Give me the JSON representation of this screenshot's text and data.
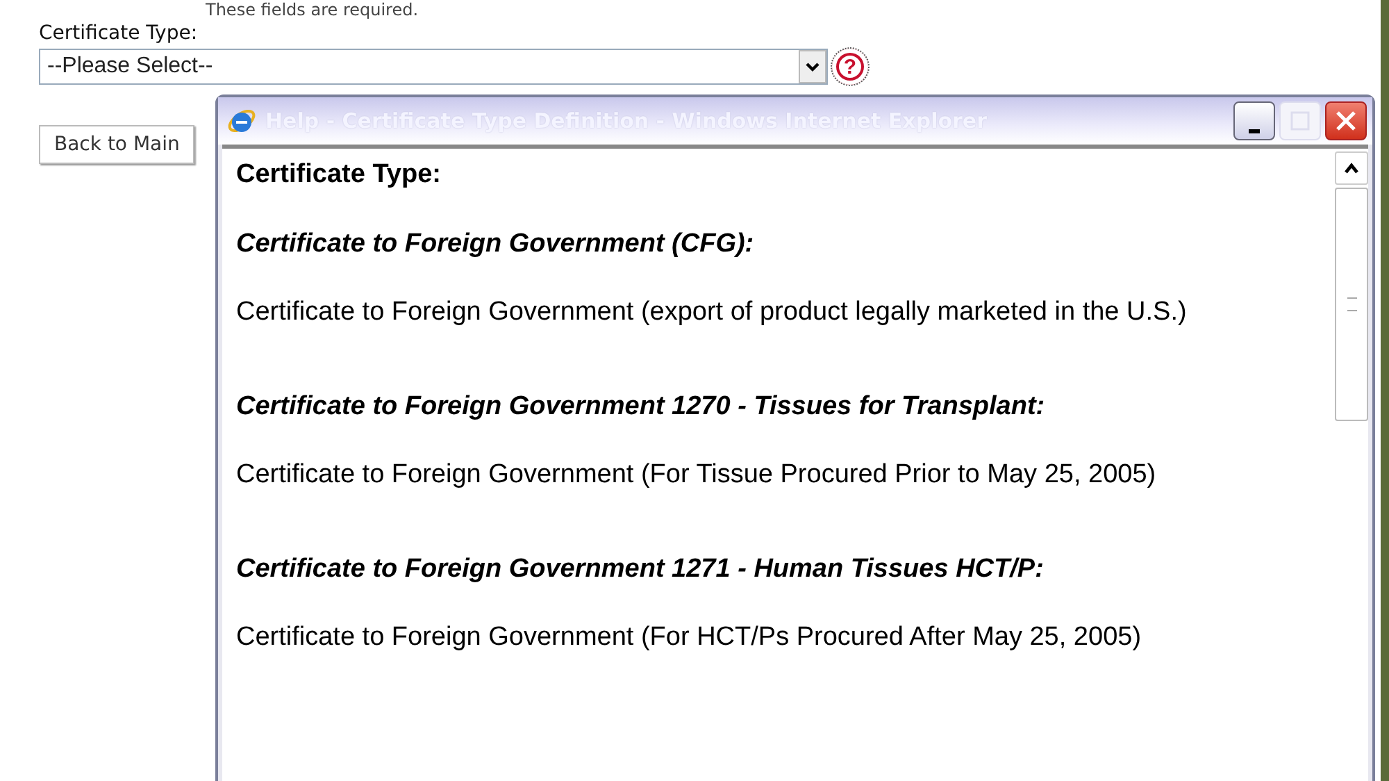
{
  "page": {
    "note": "These fields are required.",
    "field_label": "Certificate Type:",
    "select": {
      "value": "--Please Select--"
    },
    "help_icon": "?",
    "back_button": "Back to Main"
  },
  "popup": {
    "title": "Help - Certificate Type Definition - Windows Internet Explorer",
    "heading": "Certificate Type:",
    "entries": [
      {
        "term": "Certificate to Foreign Government (CFG):",
        "description": "Certificate to Foreign Government (export of product legally marketed in the U.S.)"
      },
      {
        "term": "Certificate to Foreign Government 1270 - Tissues for Transplant:",
        "description": "Certificate to Foreign Government (For Tissue Procured Prior to May 25, 2005)"
      },
      {
        "term": "Certificate to Foreign Government 1271 - Human Tissues HCT/P:",
        "description": "Certificate to Foreign Government (For HCT/Ps Procured After May 25, 2005)"
      }
    ]
  }
}
